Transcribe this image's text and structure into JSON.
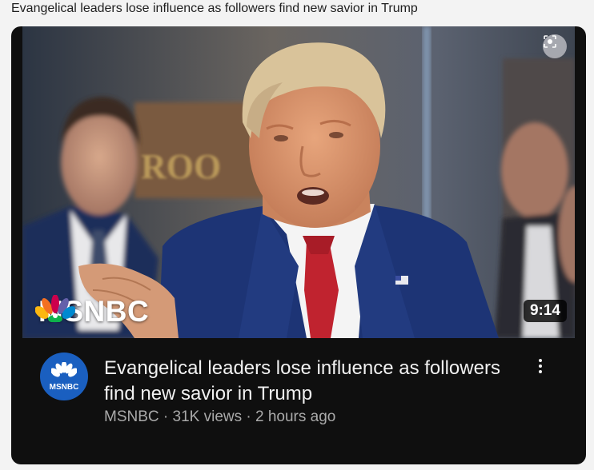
{
  "page": {
    "heading": "Evangelical leaders lose influence as followers find new savior in Trump"
  },
  "video": {
    "thumbnail_logo_text": "MSNBC",
    "duration": "9:14",
    "title": "Evangelical leaders lose influence as followers find new savior in Trump",
    "channel": "MSNBC",
    "views": "31K views",
    "age": "2 hours ago",
    "separator": "·",
    "avatar_text": "MSNBC",
    "background_sign_text": "ROO"
  },
  "colors": {
    "card_background": "#0f0f0f",
    "avatar_background": "#1a5fc0",
    "title_text": "#f1f1f1",
    "meta_text": "#aaaaaa",
    "suit": "#1d3475",
    "tie": "#c0232f"
  },
  "icons": [
    "visual-search-icon",
    "msnbc-peacock-icon",
    "more-vert-icon"
  ]
}
